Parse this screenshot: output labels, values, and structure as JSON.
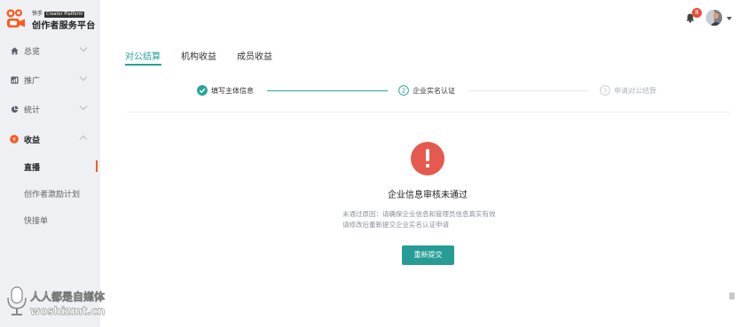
{
  "brand": {
    "small_text": "快手",
    "small_tag": "Creator Platform",
    "name": "创作者服务平台",
    "logo_colors": [
      "#ff5a1f",
      "#ff7a30"
    ]
  },
  "sidebar": {
    "items": [
      {
        "label": "总览",
        "icon": "home-icon",
        "expanded": false
      },
      {
        "label": "推广",
        "icon": "promotion-icon",
        "expanded": false
      },
      {
        "label": "统计",
        "icon": "pie-chart-icon",
        "expanded": false
      },
      {
        "label": "收益",
        "icon": "coin-icon",
        "expanded": true
      }
    ],
    "sub_items": [
      {
        "label": "直播",
        "active": true
      },
      {
        "label": "创作者激励计划",
        "active": false
      },
      {
        "label": "快接单",
        "active": false
      }
    ]
  },
  "topbar": {
    "notification_count": "8",
    "bell_icon": "bell-icon",
    "avatar_icon": "avatar-icon"
  },
  "tabs": [
    {
      "label": "对公结算",
      "active": true
    },
    {
      "label": "机构收益",
      "active": false
    },
    {
      "label": "成员收益",
      "active": false
    }
  ],
  "steps": [
    {
      "number": "1",
      "label": "填写主体信息",
      "state": "done"
    },
    {
      "number": "2",
      "label": "企业实名认证",
      "state": "current"
    },
    {
      "number": "3",
      "label": "申请对公结算",
      "state": "pending"
    }
  ],
  "result": {
    "title": "企业信息审核未通过",
    "reason_line1": "未通过原因：请确保企业信息和管理员信息真实有效",
    "reason_line2": "请修改后重新提交企业实名认证申请",
    "button_label": "重新提交"
  },
  "watermark": {
    "line1": "人人都是自媒体",
    "line2": "woshizmt.cn"
  },
  "colors": {
    "accent": "#27a39a",
    "error": "#e55a4e",
    "sidebar_bg": "#eef0f4",
    "active_marker": "#f05a22",
    "badge": "#e74c3c"
  }
}
